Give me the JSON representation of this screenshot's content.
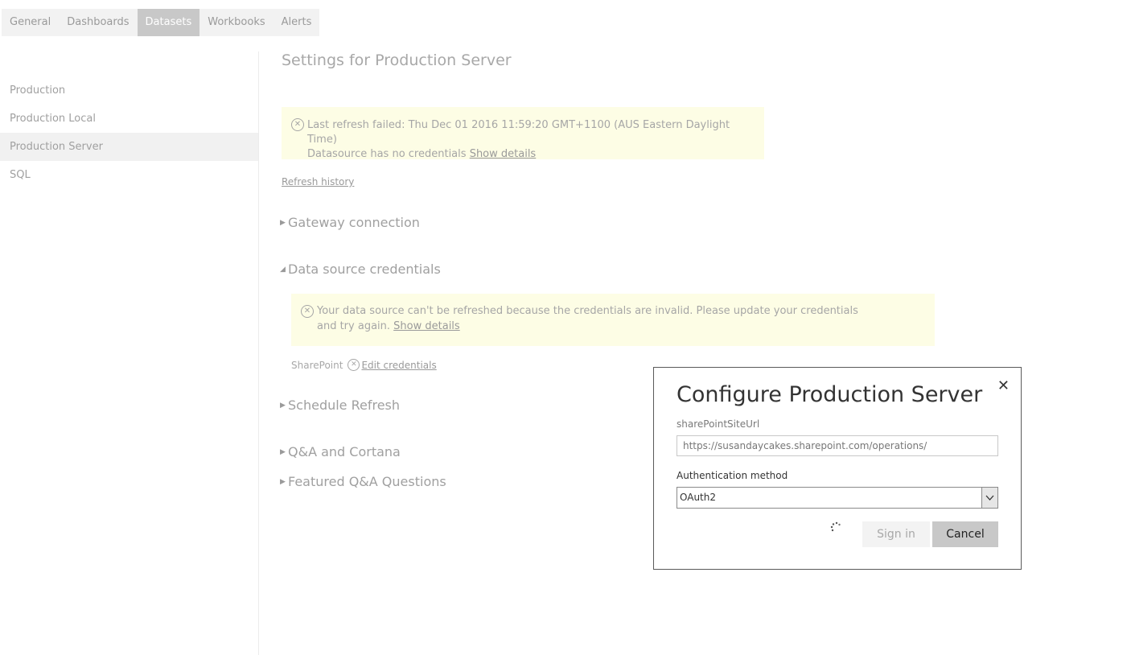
{
  "tabs": [
    "General",
    "Dashboards",
    "Datasets",
    "Workbooks",
    "Alerts"
  ],
  "sidebar": {
    "items": [
      "Production",
      "Production Local",
      "Production Server",
      "SQL"
    ],
    "selected": "Production Server"
  },
  "main": {
    "title": "Settings for Production Server",
    "refresh_alert": {
      "line1": "Last refresh failed: Thu Dec 01 2016 11:59:20 GMT+1100 (AUS Eastern Daylight Time)",
      "line2": "Datasource has no credentials",
      "link": "Show details"
    },
    "refresh_history": "Refresh history",
    "sections": {
      "gateway": "Gateway connection",
      "credentials": "Data source credentials",
      "schedule": "Schedule Refresh",
      "qa": "Q&A and Cortana",
      "featured": "Featured Q&A Questions"
    },
    "credentials_alert": {
      "text": "Your data source can't be refreshed because the credentials are invalid. Please update your credentials and try again.",
      "link": "Show details"
    },
    "sharepoint_label": "SharePoint",
    "edit_credentials": "Edit credentials"
  },
  "dialog": {
    "title": "Configure Production Server",
    "url_label": "sharePointSiteUrl",
    "url_value": "https://susandaycakes.sharepoint.com/operations/",
    "auth_label": "Authentication method",
    "auth_value": "OAuth2",
    "signin_label": "Sign in",
    "cancel_label": "Cancel",
    "close_glyph": "✕"
  },
  "colors": {
    "alert_bg": "#fdfde5",
    "active_tab": "#c8c8c8"
  }
}
